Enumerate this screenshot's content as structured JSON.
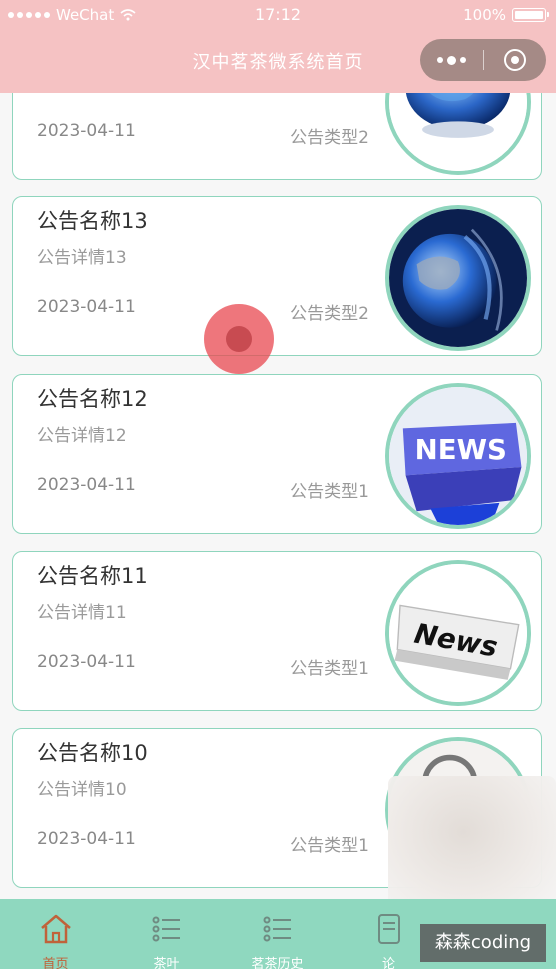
{
  "status_bar": {
    "carrier": "WeChat",
    "time": "17:12",
    "battery": "100%"
  },
  "header": {
    "title": "汉中茗茶微系统首页"
  },
  "notices": [
    {
      "name": "",
      "detail": "",
      "date": "2023-04-11",
      "type": "公告类型2",
      "icon": "globe-news-icon"
    },
    {
      "name": "公告名称13",
      "detail": "公告详情13",
      "date": "2023-04-11",
      "type": "公告类型2",
      "icon": "globe-earth-icon"
    },
    {
      "name": "公告名称12",
      "detail": "公告详情12",
      "date": "2023-04-11",
      "type": "公告类型1",
      "icon": "news-key-icon"
    },
    {
      "name": "公告名称11",
      "detail": "公告详情11",
      "date": "2023-04-11",
      "type": "公告类型1",
      "icon": "news-paper-icon"
    },
    {
      "name": "公告名称10",
      "detail": "公告详情10",
      "date": "2023-04-11",
      "type": "公告类型1",
      "icon": "news-magnifier-icon"
    }
  ],
  "tabbar": {
    "items": [
      {
        "label": "首页",
        "icon": "home-icon",
        "active": true
      },
      {
        "label": "茶叶",
        "icon": "list-icon",
        "active": false
      },
      {
        "label": "茗茶历史",
        "icon": "list-icon",
        "active": false
      },
      {
        "label": "论",
        "icon": "document-icon",
        "active": false
      }
    ]
  },
  "watermark": "森森coding",
  "colors": {
    "header_bg": "#f5c2c3",
    "card_border": "#8fd5bd",
    "tabbar_bg": "#8fd8bf",
    "active_tab": "#c0623a"
  }
}
